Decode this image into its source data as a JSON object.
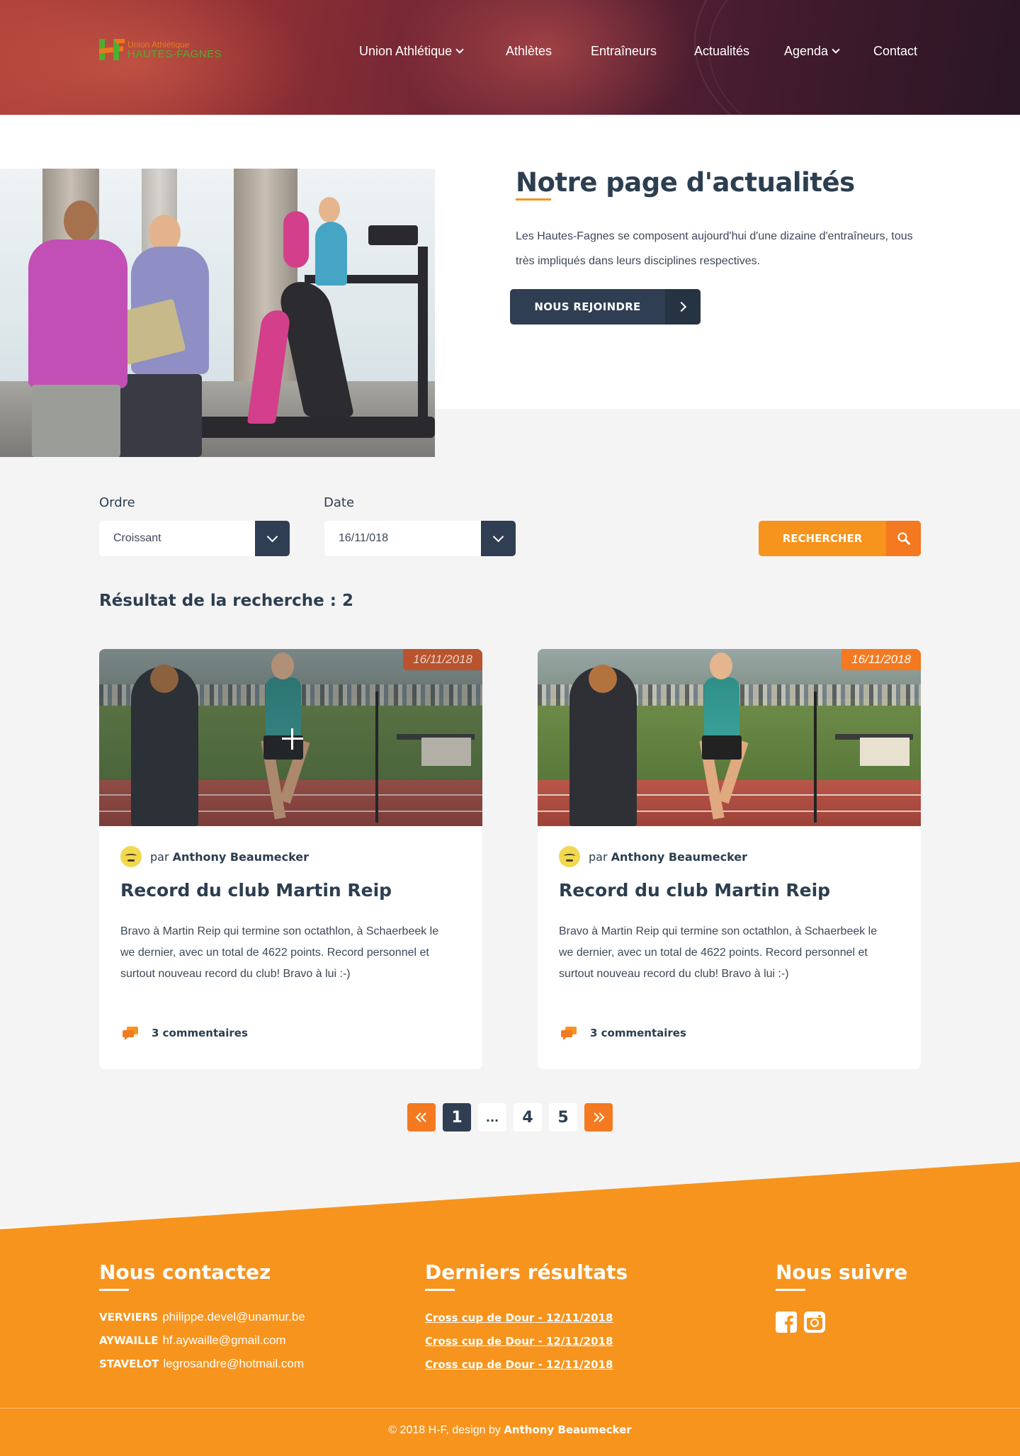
{
  "brand": {
    "line1": "Union Athlétique",
    "line2": "HAUTES-FAGNES",
    "colors": {
      "orange": "#e9791f",
      "green": "#4caf2f"
    }
  },
  "nav": {
    "items": [
      {
        "label": "Union Athlétique",
        "dropdown": true
      },
      {
        "label": "Athlètes",
        "dropdown": false
      },
      {
        "label": "Entraîneurs",
        "dropdown": false
      },
      {
        "label": "Actualités",
        "dropdown": false
      },
      {
        "label": "Agenda",
        "dropdown": true
      },
      {
        "label": "Contact",
        "dropdown": false
      }
    ]
  },
  "hero": {
    "title": "Notre page d'actualités",
    "text": "Les Hautes-Fagnes se composent aujourd'hui d'une dizaine d'entraîneurs, tous très impliqués dans leurs disciplines respectives.",
    "button_label": "NOUS REJOINDRE"
  },
  "filters": {
    "order_label": "Ordre",
    "order_value": "Croissant",
    "date_label": "Date",
    "date_value": "16/11/018",
    "search_label": "RECHERCHER"
  },
  "results": {
    "label": "Résultat de la recherche : 2"
  },
  "articles": [
    {
      "date": "16/11/2018",
      "by": "par",
      "author": "Anthony Beaumecker",
      "title": "Record du club Martin Reip",
      "text": "Bravo à Martin Reip qui termine son octathlon, à Schaerbeek le we dernier, avec un total de 4622 points. Record personnel et surtout nouveau record du club! Bravo à lui :-)",
      "comments": "3 commentaires"
    },
    {
      "date": "16/11/2018",
      "by": "par",
      "author": "Anthony Beaumecker",
      "title": "Record du club Martin Reip",
      "text": "Bravo à Martin Reip qui termine son octathlon, à Schaerbeek le we dernier, avec un total de 4622 points. Record personnel et surtout nouveau record du club! Bravo à lui :-)",
      "comments": "3 commentaires"
    }
  ],
  "pagination": {
    "prev_icon": "double-chevron-left-icon",
    "pages": [
      "1",
      "...",
      "4",
      "5"
    ],
    "current": "1",
    "next_icon": "double-chevron-right-icon"
  },
  "footer": {
    "contact_title": "Nous contactez",
    "contacts": [
      {
        "city": "VERVIERS",
        "email": "philippe.devel@unamur.be"
      },
      {
        "city": "AYWAILLE",
        "email": "hf.aywaille@gmail.com"
      },
      {
        "city": "STAVELOT",
        "email": "legrosandre@hotmail.com"
      }
    ],
    "results_title": "Derniers résultats",
    "results_links": [
      "Cross cup de Dour - 12/11/2018",
      "Cross cup de Dour - 12/11/2018",
      "Cross cup de Dour - 12/11/2018"
    ],
    "follow_title": "Nous suivre",
    "social": [
      "facebook-icon",
      "instagram-icon"
    ],
    "copyright_prefix": "© 2018 H-F, design by",
    "copyright_author": "Anthony Beaumecker",
    "colors": {
      "footer_bg": "#f7941d",
      "accent": "#f47920",
      "dark": "#2f3e52"
    }
  }
}
